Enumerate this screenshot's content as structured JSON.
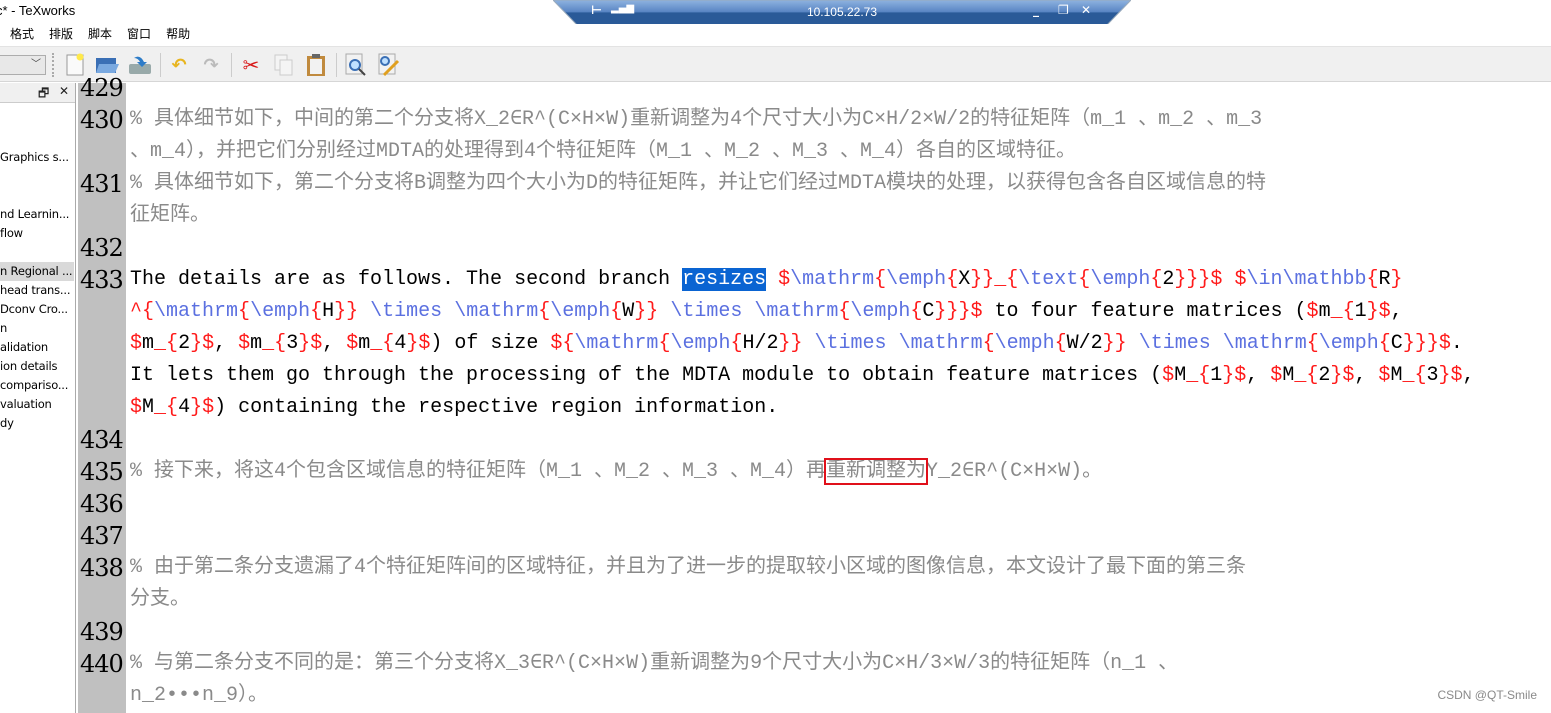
{
  "window": {
    "title": "c* - TeXworks"
  },
  "remote_bar": {
    "host": "10.105.22.73",
    "accent": "#2a5a98"
  },
  "menu": [
    "格式",
    "排版",
    "脚本",
    "窗口",
    "帮助"
  ],
  "toolbar": {
    "combo_value": "",
    "icons": [
      "new-document-icon",
      "open-folder-icon",
      "save-icon",
      "undo-icon",
      "redo-icon",
      "cut-icon",
      "copy-icon",
      "paste-icon",
      "find-icon",
      "replace-icon"
    ]
  },
  "sidebar": {
    "items": [
      {
        "label": "Graphics s...",
        "row": 2
      },
      {
        "label": "nd Learnin...",
        "row": 5
      },
      {
        "label": "flow",
        "row": 6
      },
      {
        "label": "n Regional ...",
        "row": 8,
        "selected": true
      },
      {
        "label": "head trans...",
        "row": 9
      },
      {
        "label": "Dconv Cro...",
        "row": 10
      },
      {
        "label": "n",
        "row": 11
      },
      {
        "label": "alidation",
        "row": 12
      },
      {
        "label": "ion details",
        "row": 13
      },
      {
        "label": "compariso...",
        "row": 14
      },
      {
        "label": "valuation",
        "row": 15
      },
      {
        "label": "dy",
        "row": 16
      }
    ]
  },
  "editor": {
    "rows": [
      {
        "num": "429",
        "text": ""
      },
      {
        "num": "430",
        "text": "% 具体细节如下，中间的第二个分支将X_2∈R^(C×H×W)重新调整为4个尺寸大小为C×H/2×W/2的特征矩阵（m_1 、m_2 、m_3 ",
        "comment": true
      },
      {
        "num": "",
        "text": "、m_4），并把它们分别经过MDTA的处理得到4个特征矩阵（M_1 、M_2 、M_3 、M_4）各自的区域特征。",
        "comment": true
      },
      {
        "num": "431",
        "text": "% 具体细节如下，第二个分支将B调整为四个大小为D的特征矩阵，并让它们经过MDTA模块的处理，以获得包含各自区域信息的特",
        "comment": true
      },
      {
        "num": "",
        "text": "征矩阵。",
        "comment": true
      },
      {
        "num": "432",
        "text": ""
      },
      {
        "num": "433",
        "text": "The details are as follows. The second branch resizes $\\mathrm{\\emph{X}}_{\\text{\\emph{2}}}$ $\\in\\mathbb{R}",
        "selected": "resizes"
      },
      {
        "num": "",
        "text": "^{\\mathrm{\\emph{H}} \\times \\mathrm{\\emph{W}} \\times \\mathrm{\\emph{C}}}$ to four feature matrices ($m_{1}$,"
      },
      {
        "num": "",
        "text": "$m_{2}$, $m_{3}$, $m_{4}$) of size ${\\mathrm{\\emph{H/2}} \\times \\mathrm{\\emph{W/2}} \\times \\mathrm{\\emph{C}}}$."
      },
      {
        "num": "",
        "text": "It lets them go through the processing of the MDTA module to obtain feature matrices ($M_{1}$, $M_{2}$, $M_{3}$,"
      },
      {
        "num": "",
        "text": "$M_{4}$) containing the respective region information."
      },
      {
        "num": "434",
        "text": ""
      },
      {
        "num": "435",
        "text": "% 接下来，将这4个包含区域信息的特征矩阵（M_1 、M_2 、M_3 、M_4）再重新调整为Y_2∈R^(C×H×W)。",
        "comment": true,
        "boxed": "重新调整为"
      },
      {
        "num": "436",
        "text": ""
      },
      {
        "num": "437",
        "text": ""
      },
      {
        "num": "438",
        "text": "% 由于第二条分支遗漏了4个特征矩阵间的区域特征，并且为了进一步的提取较小区域的图像信息，本文设计了最下面的第三条",
        "comment": true
      },
      {
        "num": "",
        "text": "分支。",
        "comment": true
      },
      {
        "num": "439",
        "text": ""
      },
      {
        "num": "440",
        "text": "% 与第二条分支不同的是：第三个分支将X_3∈R^(C×H×W)重新调整为9个尺寸大小为C×H/3×W/3的特征矩阵（n_1 、",
        "comment": true
      },
      {
        "num": "",
        "text": "n_2•••n_9）。",
        "comment": true
      }
    ]
  },
  "watermark": "CSDN @QT-Smile"
}
